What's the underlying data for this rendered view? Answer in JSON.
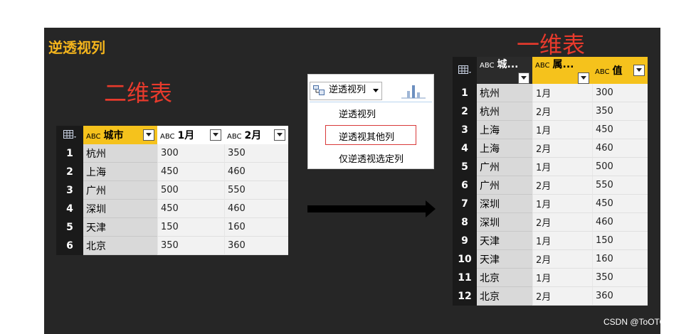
{
  "title": "逆透视列",
  "label_2d": "二维表",
  "label_1d": "一维表",
  "watermark": "CSDN @ToOTOooo",
  "table_icon": "table-icon",
  "type_badge": "ABC",
  "left_table": {
    "headers": [
      "城市",
      "1月",
      "2月"
    ],
    "rows": [
      [
        "1",
        "杭州",
        "300",
        "350"
      ],
      [
        "2",
        "上海",
        "450",
        "460"
      ],
      [
        "3",
        "广州",
        "500",
        "550"
      ],
      [
        "4",
        "深圳",
        "450",
        "460"
      ],
      [
        "5",
        "天津",
        "150",
        "160"
      ],
      [
        "6",
        "北京",
        "350",
        "360"
      ]
    ]
  },
  "menu": {
    "button_label": "逆透视列",
    "items": [
      "逆透视列",
      "逆透视其他列",
      "仅逆透视选定列"
    ]
  },
  "right_table": {
    "headers": [
      "城...",
      "属...",
      "值"
    ],
    "rows": [
      [
        "1",
        "杭州",
        "1月",
        "300"
      ],
      [
        "2",
        "杭州",
        "2月",
        "350"
      ],
      [
        "3",
        "上海",
        "1月",
        "450"
      ],
      [
        "4",
        "上海",
        "2月",
        "460"
      ],
      [
        "5",
        "广州",
        "1月",
        "500"
      ],
      [
        "6",
        "广州",
        "2月",
        "550"
      ],
      [
        "7",
        "深圳",
        "1月",
        "450"
      ],
      [
        "8",
        "深圳",
        "2月",
        "460"
      ],
      [
        "9",
        "天津",
        "1月",
        "150"
      ],
      [
        "10",
        "天津",
        "2月",
        "160"
      ],
      [
        "11",
        "北京",
        "1月",
        "350"
      ],
      [
        "12",
        "北京",
        "2月",
        "360"
      ]
    ]
  }
}
